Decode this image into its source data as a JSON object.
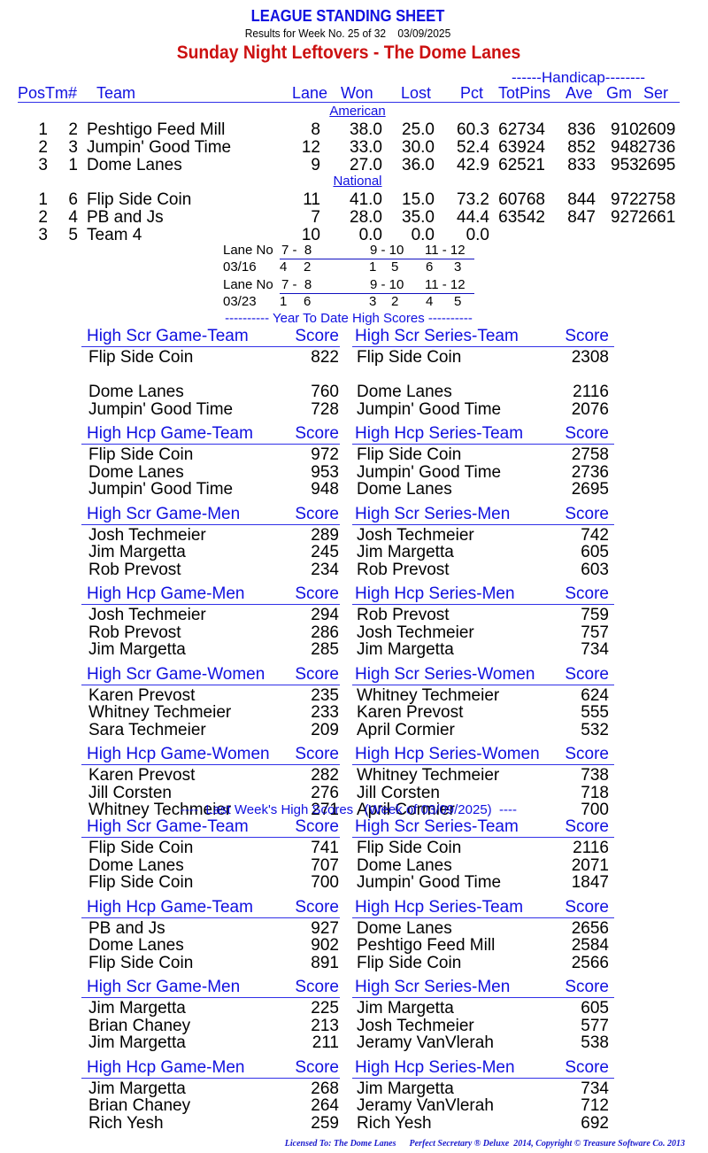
{
  "header": {
    "title": "LEAGUE STANDING SHEET",
    "subtitle": "Results for Week No. 25 of 32    03/09/2025",
    "league_name": "Sunday Night Leftovers - The Dome Lanes",
    "handicap_label": "------Handicap--------"
  },
  "standings": {
    "columns": {
      "pos_tm": "PosTm#",
      "team": "Team",
      "lane": "Lane",
      "won": "Won",
      "lost": "Lost",
      "pct": "Pct",
      "totpins": "TotPins",
      "ave": "Ave",
      "gm": "Gm",
      "ser": "Ser"
    },
    "divisions": [
      {
        "name": "American",
        "rows": [
          {
            "pos": "1",
            "tm": "2",
            "team": "Peshtigo Feed Mill",
            "lane": "8",
            "won": "38.0",
            "lost": "25.0",
            "pct": "60.3",
            "totpins": "62734",
            "ave": "836",
            "gm": "910",
            "ser": "2609"
          },
          {
            "pos": "2",
            "tm": "3",
            "team": "Jumpin' Good Time",
            "lane": "12",
            "won": "33.0",
            "lost": "30.0",
            "pct": "52.4",
            "totpins": "63924",
            "ave": "852",
            "gm": "948",
            "ser": "2736"
          },
          {
            "pos": "3",
            "tm": "1",
            "team": "Dome Lanes",
            "lane": "9",
            "won": "27.0",
            "lost": "36.0",
            "pct": "42.9",
            "totpins": "62521",
            "ave": "833",
            "gm": "953",
            "ser": "2695"
          }
        ]
      },
      {
        "name": "National",
        "rows": [
          {
            "pos": "1",
            "tm": "6",
            "team": "Flip Side Coin",
            "lane": "11",
            "won": "41.0",
            "lost": "15.0",
            "pct": "73.2",
            "totpins": "60768",
            "ave": "844",
            "gm": "972",
            "ser": "2758"
          },
          {
            "pos": "2",
            "tm": "4",
            "team": "PB and Js",
            "lane": "7",
            "won": "28.0",
            "lost": "35.0",
            "pct": "44.4",
            "totpins": "63542",
            "ave": "847",
            "gm": "927",
            "ser": "2661"
          },
          {
            "pos": "3",
            "tm": "5",
            "team": "Team 4",
            "lane": "10",
            "won": "0.0",
            "lost": "0.0",
            "pct": "0.0",
            "totpins": "",
            "ave": "",
            "gm": "",
            "ser": ""
          }
        ]
      }
    ]
  },
  "lane_schedule": [
    {
      "label": "Lane No",
      "pairs": [
        "7 -  8",
        "9 - 10",
        "11 - 12"
      ],
      "date": "03/16",
      "teams": [
        [
          "4",
          "2"
        ],
        [
          "1",
          "5"
        ],
        [
          "6",
          "3"
        ]
      ]
    },
    {
      "label": "Lane No",
      "pairs": [
        "7 -  8",
        "9 - 10",
        "11 - 12"
      ],
      "date": "03/23",
      "teams": [
        [
          "1",
          "6"
        ],
        [
          "3",
          "2"
        ],
        [
          "4",
          "5"
        ]
      ]
    }
  ],
  "ytd": {
    "title": "---------- Year To Date High Scores ----------",
    "score_label": "Score",
    "blocks": [
      {
        "left": {
          "title": "High Scr Game-Team",
          "rows": [
            [
              "Flip Side Coin",
              "822"
            ],
            [
              "",
              ""
            ],
            [
              "Dome Lanes",
              "760"
            ],
            [
              "Jumpin' Good Time",
              "728"
            ]
          ]
        },
        "right": {
          "title": "High Scr Series-Team",
          "rows": [
            [
              "Flip Side Coin",
              "2308"
            ],
            [
              "",
              ""
            ],
            [
              "Dome Lanes",
              "2116"
            ],
            [
              "Jumpin' Good Time",
              "2076"
            ]
          ]
        }
      },
      {
        "left": {
          "title": "High Hcp Game-Team",
          "rows": [
            [
              "Flip Side Coin",
              "972"
            ],
            [
              "Dome Lanes",
              "953"
            ],
            [
              "Jumpin' Good Time",
              "948"
            ]
          ]
        },
        "right": {
          "title": "High Hcp Series-Team",
          "rows": [
            [
              "Flip Side Coin",
              "2758"
            ],
            [
              "Jumpin' Good Time",
              "2736"
            ],
            [
              "Dome Lanes",
              "2695"
            ]
          ]
        }
      },
      {
        "left": {
          "title": "High Scr Game-Men",
          "rows": [
            [
              "Josh Techmeier",
              "289"
            ],
            [
              "Jim Margetta",
              "245"
            ],
            [
              "Rob Prevost",
              "234"
            ]
          ]
        },
        "right": {
          "title": "High Scr Series-Men",
          "rows": [
            [
              "Josh Techmeier",
              "742"
            ],
            [
              "Jim Margetta",
              "605"
            ],
            [
              "Rob Prevost",
              "603"
            ]
          ]
        }
      },
      {
        "left": {
          "title": "High Hcp Game-Men",
          "rows": [
            [
              "Josh Techmeier",
              "294"
            ],
            [
              "Rob Prevost",
              "286"
            ],
            [
              "Jim Margetta",
              "285"
            ]
          ]
        },
        "right": {
          "title": "High Hcp Series-Men",
          "rows": [
            [
              "Rob Prevost",
              "759"
            ],
            [
              "Josh Techmeier",
              "757"
            ],
            [
              "Jim Margetta",
              "734"
            ]
          ]
        }
      },
      {
        "left": {
          "title": "High Scr Game-Women",
          "rows": [
            [
              "Karen Prevost",
              "235"
            ],
            [
              "Whitney Techmeier",
              "233"
            ],
            [
              "Sara Techmeier",
              "209"
            ]
          ]
        },
        "right": {
          "title": "High Scr Series-Women",
          "rows": [
            [
              "Whitney Techmeier",
              "624"
            ],
            [
              "Karen Prevost",
              "555"
            ],
            [
              "April Cormier",
              "532"
            ]
          ]
        }
      },
      {
        "left": {
          "title": "High Hcp Game-Women",
          "rows": [
            [
              "Karen Prevost",
              "282"
            ],
            [
              "Jill Corsten",
              "276"
            ],
            [
              "Whitney Techmeier",
              "271"
            ]
          ]
        },
        "right": {
          "title": "High Hcp Series-Women",
          "rows": [
            [
              "Whitney Techmeier",
              "738"
            ],
            [
              "Jill Corsten",
              "718"
            ],
            [
              "April Cormier",
              "700"
            ]
          ]
        }
      }
    ]
  },
  "last_week": {
    "title": "----  Last Week's High Scores   (Week of 03/09/2025)  ----",
    "score_label": "Score",
    "blocks": [
      {
        "left": {
          "title": "High Scr Game-Team",
          "rows": [
            [
              "Flip Side Coin",
              "741"
            ],
            [
              "Dome Lanes",
              "707"
            ],
            [
              "Flip Side Coin",
              "700"
            ]
          ]
        },
        "right": {
          "title": "High Scr Series-Team",
          "rows": [
            [
              "Flip Side Coin",
              "2116"
            ],
            [
              "Dome Lanes",
              "2071"
            ],
            [
              "Jumpin' Good Time",
              "1847"
            ]
          ]
        }
      },
      {
        "left": {
          "title": "High Hcp Game-Team",
          "rows": [
            [
              "PB and Js",
              "927"
            ],
            [
              "Dome Lanes",
              "902"
            ],
            [
              "Flip Side Coin",
              "891"
            ]
          ]
        },
        "right": {
          "title": "High Hcp Series-Team",
          "rows": [
            [
              "Dome Lanes",
              "2656"
            ],
            [
              "Peshtigo Feed Mill",
              "2584"
            ],
            [
              "Flip Side Coin",
              "2566"
            ]
          ]
        }
      },
      {
        "left": {
          "title": "High Scr Game-Men",
          "rows": [
            [
              "Jim Margetta",
              "225"
            ],
            [
              "Brian Chaney",
              "213"
            ],
            [
              "Jim Margetta",
              "211"
            ]
          ]
        },
        "right": {
          "title": "High Scr Series-Men",
          "rows": [
            [
              "Jim Margetta",
              "605"
            ],
            [
              "Josh Techmeier",
              "577"
            ],
            [
              "Jeramy VanVlerah",
              "538"
            ]
          ]
        }
      },
      {
        "left": {
          "title": "High Hcp Game-Men",
          "rows": [
            [
              "Jim Margetta",
              "268"
            ],
            [
              "Brian Chaney",
              "264"
            ],
            [
              "Rich Yesh",
              "259"
            ]
          ]
        },
        "right": {
          "title": "High Hcp Series-Men",
          "rows": [
            [
              "Jim Margetta",
              "734"
            ],
            [
              "Jeramy VanVlerah",
              "712"
            ],
            [
              "Rich Yesh",
              "692"
            ]
          ]
        }
      }
    ]
  },
  "footer": {
    "text": "Licensed To: The Dome Lanes      Perfect Secretary ® Deluxe  2014, Copyright © Treasure Software Co. 2013"
  }
}
